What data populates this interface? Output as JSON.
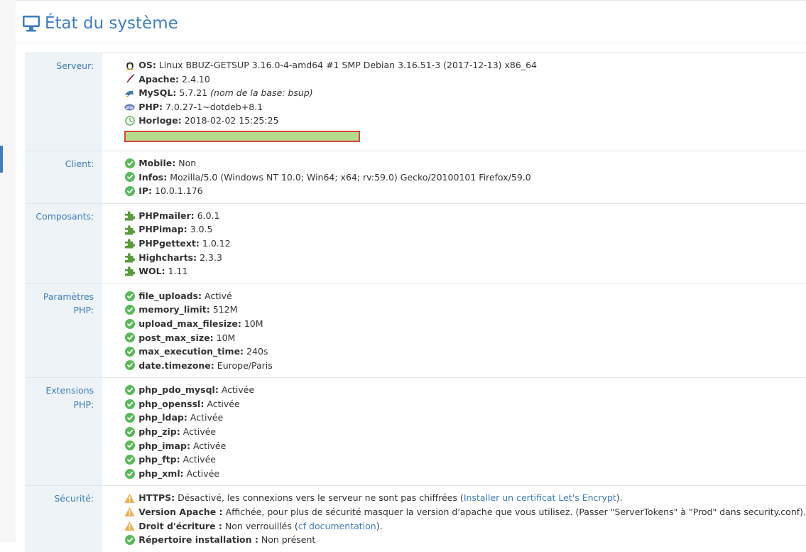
{
  "header": {
    "title": "État du système"
  },
  "sections": {
    "server": {
      "label": "Serveur:",
      "os": {
        "key": "OS:",
        "value": "Linux BBUZ-GETSUP 3.16.0-4-amd64 #1 SMP Debian 3.16.51-3 (2017-12-13) x86_64"
      },
      "apache": {
        "key": "Apache:",
        "value": "2.4.10"
      },
      "mysql": {
        "key": "MySQL:",
        "value": "5.7.21",
        "note": "(nom de la base: bsup)"
      },
      "php": {
        "key": "PHP:",
        "value": "7.0.27-1~dotdeb+8.1"
      },
      "clock": {
        "key": "Horloge:",
        "value": "2018-02-02 15:25:25"
      },
      "progress": 1.0
    },
    "client": {
      "label": "Client:",
      "items": [
        {
          "key": "Mobile:",
          "value": "Non"
        },
        {
          "key": "Infos:",
          "value": "Mozilla/5.0 (Windows NT 10.0; Win64; x64; rv:59.0) Gecko/20100101 Firefox/59.0"
        },
        {
          "key": "IP:",
          "value": "10.0.1.176"
        }
      ]
    },
    "components": {
      "label": "Composants:",
      "items": [
        {
          "key": "PHPmailer:",
          "value": "6.0.1"
        },
        {
          "key": "PHPimap:",
          "value": "3.0.5"
        },
        {
          "key": "PHPgettext:",
          "value": "1.0.12"
        },
        {
          "key": "Highcharts:",
          "value": "2.3.3"
        },
        {
          "key": "WOL:",
          "value": "1.11"
        }
      ]
    },
    "php_params": {
      "label_line1": "Paramètres",
      "label_line2": "PHP:",
      "items": [
        {
          "key": "file_uploads:",
          "value": "Activé"
        },
        {
          "key": "memory_limit:",
          "value": "512M"
        },
        {
          "key": "upload_max_filesize:",
          "value": "10M"
        },
        {
          "key": "post_max_size:",
          "value": "10M"
        },
        {
          "key": "max_execution_time:",
          "value": "240s"
        },
        {
          "key": "date.timezone:",
          "value": "Europe/Paris"
        }
      ]
    },
    "php_ext": {
      "label": "Extensions PHP:",
      "items": [
        {
          "key": "php_pdo_mysql:",
          "value": "Activée"
        },
        {
          "key": "php_openssl:",
          "value": "Activée"
        },
        {
          "key": "php_ldap:",
          "value": "Activée"
        },
        {
          "key": "php_zip:",
          "value": "Activée"
        },
        {
          "key": "php_imap:",
          "value": "Activée"
        },
        {
          "key": "php_ftp:",
          "value": "Activée"
        },
        {
          "key": "php_xml:",
          "value": "Activée"
        }
      ]
    },
    "security": {
      "label": "Sécurité:",
      "https": {
        "key": "HTTPS:",
        "text": "Désactivé, les connexions vers le serveur ne sont pas chiffrées",
        "open": "(",
        "link": "Installer un certificat Let's Encrypt",
        "close": ")."
      },
      "apache_version": {
        "key": "Version Apache :",
        "text": "Affichée, pour plus de sécurité masquer la version d'apache que vous utilisez. (Passer \"ServerTokens\" à \"Prod\" dans security.conf)."
      },
      "write_access": {
        "key": "Droit d'écriture :",
        "text": "Non verrouillés",
        "open": "(",
        "link": "cf documentation",
        "close": ")."
      },
      "install_dir": {
        "key": "Répertoire installation :",
        "text": "Non présent"
      }
    }
  },
  "colors": {
    "accent": "#3d7dbf",
    "ok": "#5cb85c",
    "warning": "#f0ad4e",
    "label_bg": "#edf3f6",
    "progress_border": "#d9463d",
    "progress_fill": "#b5dc8c"
  },
  "icons": {
    "title": "monitor-icon",
    "os": "linux-tux-icon",
    "apache": "apache-feather-icon",
    "mysql": "mysql-dolphin-icon",
    "php": "php-logo-icon",
    "clock": "clock-icon",
    "ok": "check-circle-icon",
    "component": "puzzle-icon",
    "warning": "warning-triangle-icon"
  }
}
